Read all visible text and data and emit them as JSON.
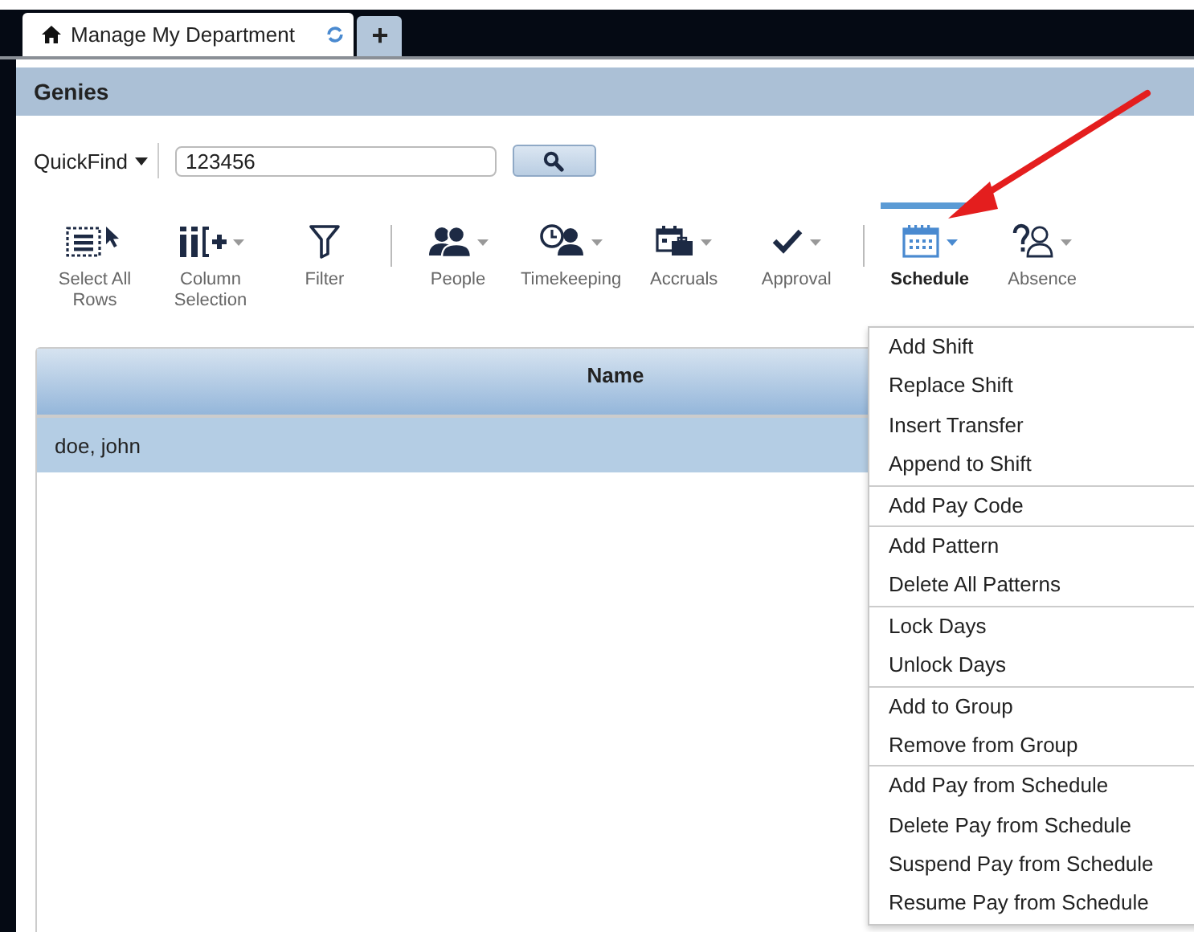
{
  "tabs": [
    {
      "label": "Manage My Department",
      "selected": true,
      "kind": "page"
    },
    {
      "label": "+",
      "selected": false,
      "kind": "add"
    }
  ],
  "panel": {
    "title": "Genies"
  },
  "quickfind": {
    "label": "QuickFind",
    "value": "123456"
  },
  "toolbar": [
    {
      "label": "Select All Rows",
      "dropdown": false,
      "divider_before": false,
      "selected": false
    },
    {
      "label": "Column Selection",
      "dropdown": true,
      "divider_before": false,
      "selected": false
    },
    {
      "label": "Filter",
      "dropdown": false,
      "divider_before": false,
      "selected": false
    },
    {
      "label": "People",
      "dropdown": true,
      "divider_before": true,
      "selected": false
    },
    {
      "label": "Timekeeping",
      "dropdown": true,
      "divider_before": false,
      "selected": false
    },
    {
      "label": "Accruals",
      "dropdown": true,
      "divider_before": false,
      "selected": false
    },
    {
      "label": "Approval",
      "dropdown": true,
      "divider_before": false,
      "selected": false
    },
    {
      "label": "Schedule",
      "dropdown": true,
      "divider_before": true,
      "selected": true
    },
    {
      "label": "Absence",
      "dropdown": true,
      "divider_before": false,
      "selected": false
    }
  ],
  "table": {
    "columns": [
      "Name"
    ],
    "rows": [
      {
        "cells": [
          "doe, john"
        ],
        "selected": true
      }
    ]
  },
  "menu": {
    "groups": [
      [
        "Add Shift",
        "Replace Shift",
        "Insert Transfer",
        "Append to Shift"
      ],
      [
        "Add Pay Code"
      ],
      [
        "Add Pattern",
        "Delete All Patterns"
      ],
      [
        "Lock Days",
        "Unlock Days"
      ],
      [
        "Add to Group",
        "Remove from Group"
      ],
      [
        "Add Pay from Schedule",
        "Delete Pay from Schedule",
        "Suspend Pay from Schedule",
        "Resume Pay from Schedule"
      ]
    ]
  }
}
